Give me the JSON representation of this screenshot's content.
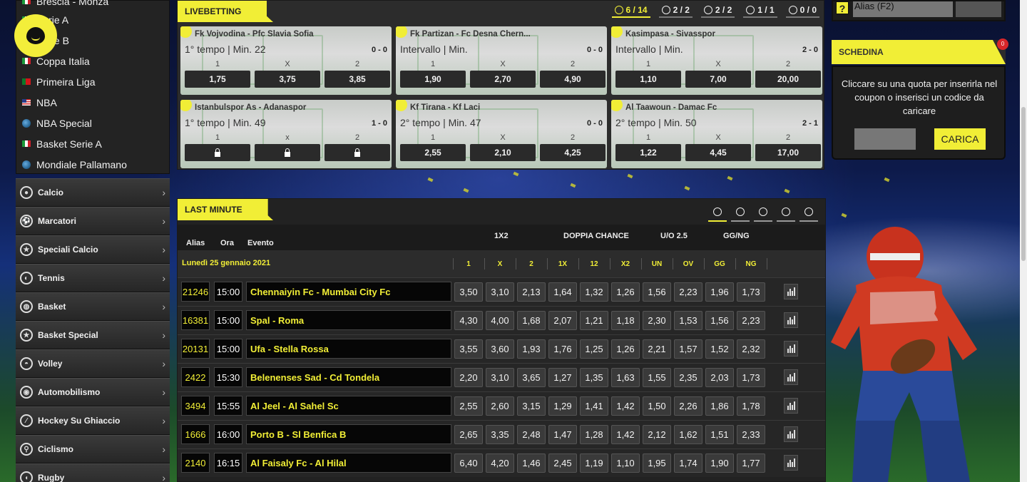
{
  "leagues": [
    {
      "label": "Brescia - Monza",
      "flag": "it"
    },
    {
      "label": "Serie A",
      "flag": "it"
    },
    {
      "label": "Serie B",
      "flag": "it"
    },
    {
      "label": "Coppa Italia",
      "flag": "it"
    },
    {
      "label": "Primeira Liga",
      "flag": "pt"
    },
    {
      "label": "NBA",
      "flag": "us"
    },
    {
      "label": "NBA Special",
      "flag": "globe"
    },
    {
      "label": "Basket Serie A",
      "flag": "it"
    },
    {
      "label": "Mondiale Pallamano",
      "flag": "globe"
    }
  ],
  "sports": [
    {
      "label": "Calcio",
      "icon": "soccer-ball-icon"
    },
    {
      "label": "Marcatori",
      "icon": "kick-icon"
    },
    {
      "label": "Speciali Calcio",
      "icon": "star-ball-icon"
    },
    {
      "label": "Tennis",
      "icon": "tennis-ball-icon"
    },
    {
      "label": "Basket",
      "icon": "basketball-icon"
    },
    {
      "label": "Basket Special",
      "icon": "star-basketball-icon"
    },
    {
      "label": "Volley",
      "icon": "volleyball-icon"
    },
    {
      "label": "Automobilismo",
      "icon": "helmet-icon"
    },
    {
      "label": "Hockey Su Ghiaccio",
      "icon": "hockey-puck-icon"
    },
    {
      "label": "Ciclismo",
      "icon": "bicycle-icon"
    },
    {
      "label": "Rugby",
      "icon": "rugby-ball-icon"
    }
  ],
  "livebetting": {
    "title": "LIVEBETTING",
    "counts": [
      {
        "value": "6 / 14",
        "icon": "soccer-ball-icon",
        "active": true
      },
      {
        "value": "2 / 2",
        "icon": "tennis-ball-icon",
        "active": false
      },
      {
        "value": "2 / 2",
        "icon": "basketball-icon",
        "active": false
      },
      {
        "value": "1 / 1",
        "icon": "hockey-icon",
        "active": false
      },
      {
        "value": "0 / 0",
        "icon": "volleyball-icon",
        "active": false
      }
    ],
    "matches": [
      {
        "teams": "Fk Vojvodina - Pfc Slavia Sofia",
        "status": "1° tempo | Min. 22",
        "score": "0 - 0",
        "labels": [
          "1",
          "X",
          "2"
        ],
        "odds": [
          "1,75",
          "3,75",
          "3,85"
        ],
        "locked": false
      },
      {
        "teams": "Fk Partizan - Fc Desna Chern...",
        "status": "Intervallo | Min.",
        "score": "0 - 0",
        "labels": [
          "1",
          "X",
          "2"
        ],
        "odds": [
          "1,90",
          "2,70",
          "4,90"
        ],
        "locked": false
      },
      {
        "teams": "Kasimpasa - Sivasspor",
        "status": "Intervallo | Min.",
        "score": "2 - 0",
        "labels": [
          "1",
          "X",
          "2"
        ],
        "odds": [
          "1,10",
          "7,00",
          "20,00"
        ],
        "locked": false
      },
      {
        "teams": "Istanbulspor As - Adanaspor",
        "status": "1° tempo | Min. 49",
        "score": "1 - 0",
        "labels": [
          "1",
          "x",
          "2"
        ],
        "odds": [
          "",
          "",
          ""
        ],
        "locked": true
      },
      {
        "teams": "Kf Tirana - Kf Laci",
        "status": "2° tempo | Min. 47",
        "score": "0 - 0",
        "labels": [
          "1",
          "X",
          "2"
        ],
        "odds": [
          "2,55",
          "2,10",
          "4,25"
        ],
        "locked": false
      },
      {
        "teams": "Al Taawoun - Damac Fc",
        "status": "2° tempo | Min. 50",
        "score": "2 - 1",
        "labels": [
          "1",
          "X",
          "2"
        ],
        "odds": [
          "1,22",
          "4,45",
          "17,00"
        ],
        "locked": false
      }
    ]
  },
  "last_minute": {
    "title": "LAST MINUTE",
    "filters": [
      "soccer-ball-icon",
      "hockey-icon",
      "tennis-ball-icon",
      "basketball-icon",
      "volleyball-icon"
    ],
    "head": {
      "alias": "Alias",
      "ora": "Ora",
      "evento": "Evento",
      "g1": "1X2",
      "g2": "DOPPIA CHANCE",
      "g3": "U/O 2.5",
      "g4": "GG/NG"
    },
    "date": "Lunedì 25 gennaio 2021",
    "columns": [
      "1",
      "X",
      "2",
      "1X",
      "12",
      "X2",
      "UN",
      "OV",
      "GG",
      "NG"
    ],
    "rows": [
      {
        "alias": "21246",
        "ora": "15:00",
        "evento": "Chennaiyin Fc - Mumbai City Fc",
        "odds": [
          "3,50",
          "3,10",
          "2,13",
          "1,64",
          "1,32",
          "1,26",
          "1,56",
          "2,23",
          "1,96",
          "1,73"
        ]
      },
      {
        "alias": "16381",
        "ora": "15:00",
        "evento": "Spal - Roma",
        "odds": [
          "4,30",
          "4,00",
          "1,68",
          "2,07",
          "1,21",
          "1,18",
          "2,30",
          "1,53",
          "1,56",
          "2,23"
        ]
      },
      {
        "alias": "20131",
        "ora": "15:00",
        "evento": "Ufa - Stella Rossa",
        "odds": [
          "3,55",
          "3,60",
          "1,93",
          "1,76",
          "1,25",
          "1,26",
          "2,21",
          "1,57",
          "1,52",
          "2,32"
        ]
      },
      {
        "alias": "2422",
        "ora": "15:30",
        "evento": "Belenenses Sad - Cd Tondela",
        "odds": [
          "2,20",
          "3,10",
          "3,65",
          "1,27",
          "1,35",
          "1,63",
          "1,55",
          "2,35",
          "2,03",
          "1,73"
        ]
      },
      {
        "alias": "3494",
        "ora": "15:55",
        "evento": "Al Jeel - Al Sahel Sc",
        "odds": [
          "2,55",
          "2,60",
          "3,15",
          "1,29",
          "1,41",
          "1,42",
          "1,50",
          "2,26",
          "1,86",
          "1,78"
        ]
      },
      {
        "alias": "1666",
        "ora": "16:00",
        "evento": "Porto B - Sl Benfica B",
        "odds": [
          "2,65",
          "3,35",
          "2,48",
          "1,47",
          "1,28",
          "1,42",
          "2,12",
          "1,62",
          "1,51",
          "2,33"
        ]
      },
      {
        "alias": "2140",
        "ora": "16:15",
        "evento": "Al Faisaly Fc - Al Hilal",
        "odds": [
          "6,40",
          "4,20",
          "1,46",
          "2,45",
          "1,19",
          "1,10",
          "1,95",
          "1,74",
          "1,90",
          "1,77"
        ]
      }
    ]
  },
  "alias_box": {
    "help": "?",
    "placeholder": "Alias (F2)"
  },
  "coupon": {
    "title": "SCHEDINA",
    "badge": "0",
    "text": "Cliccare su una quota per inserirla nel coupon o inserisci un codice da caricare",
    "button": "CARICA"
  },
  "colors": {
    "accent": "#f1ee36",
    "panel": "#2c2c2c",
    "odd_bg": "#3a3a3a"
  }
}
